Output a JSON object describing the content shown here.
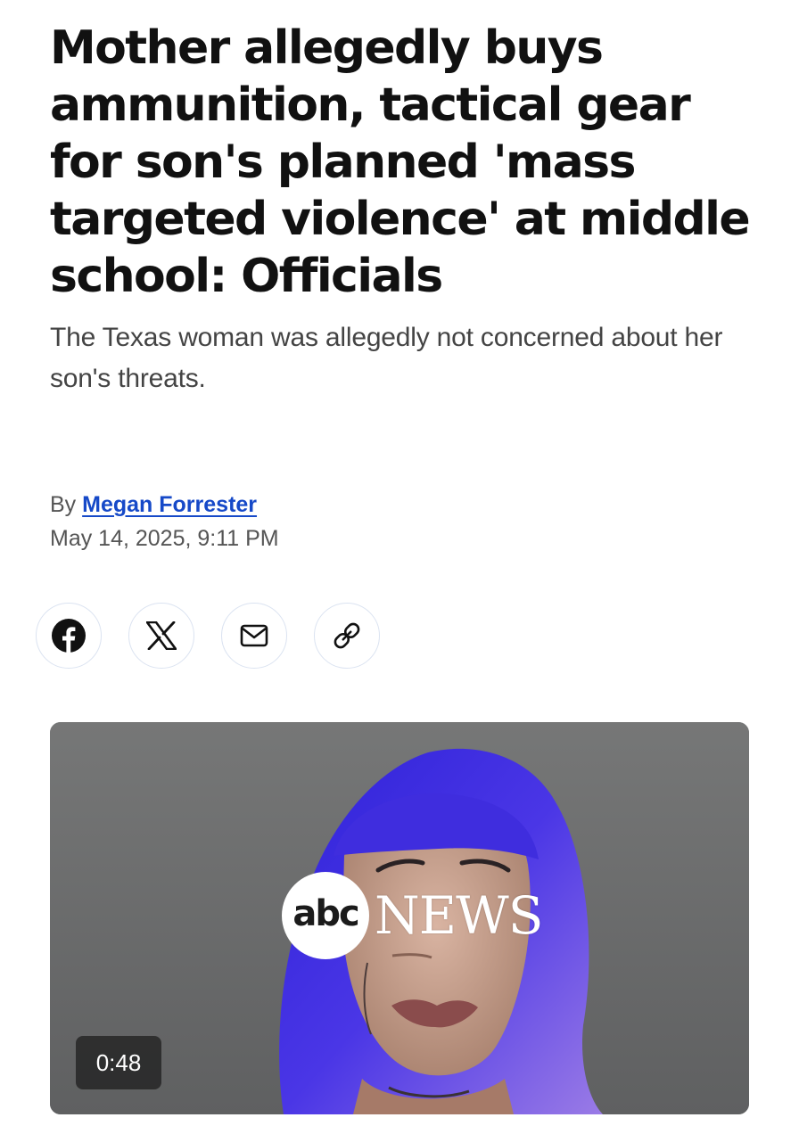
{
  "article": {
    "headline": "Mother allegedly buys ammunition, tactical gear for son's planned 'mass targeted violence' at middle school: Officials",
    "subheadline": "The Texas woman was allegedly not concerned about her son's threats.",
    "byline_prefix": "By",
    "author": "Megan Forrester",
    "date": "May 14, 2025, 9:11 PM"
  },
  "share": [
    {
      "name": "facebook",
      "icon": "facebook-icon"
    },
    {
      "name": "x",
      "icon": "x-icon"
    },
    {
      "name": "email",
      "icon": "mail-icon"
    },
    {
      "name": "copy-link",
      "icon": "link-icon"
    }
  ],
  "video": {
    "logo_abc": "abc",
    "logo_news": "NEWS",
    "duration": "0:48"
  },
  "colors": {
    "author_link": "#1649c8",
    "text": "#111111",
    "muted_text": "#555555",
    "share_border": "#dbe3f1"
  }
}
